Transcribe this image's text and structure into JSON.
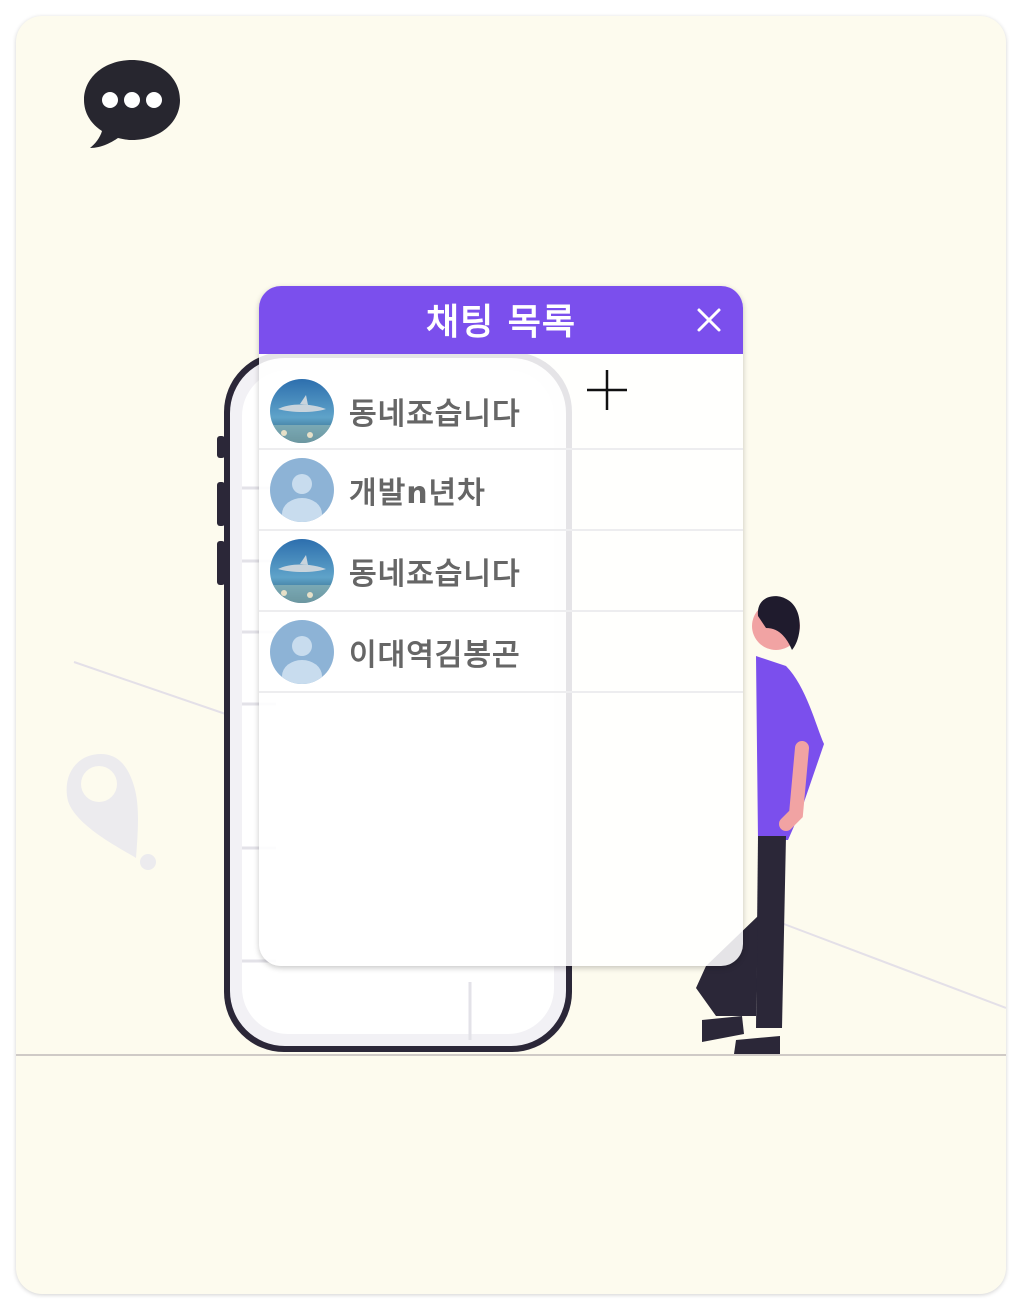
{
  "chat_panel": {
    "title": "채팅 목록",
    "close_icon": "close-icon",
    "rooms": [
      {
        "name": "동네죠습니다",
        "avatar": "shark-photo"
      },
      {
        "name": "개발n년차",
        "avatar": "default-user"
      },
      {
        "name": "동네죠습니다",
        "avatar": "shark-photo"
      },
      {
        "name": "이대역김봉곤",
        "avatar": "default-user"
      }
    ]
  },
  "logo_icon": "chat-bubble-icon",
  "colors": {
    "accent": "#7b4fed",
    "background": "#fdfbee",
    "text": "#666666",
    "avatar_default": "#8db3d6"
  }
}
